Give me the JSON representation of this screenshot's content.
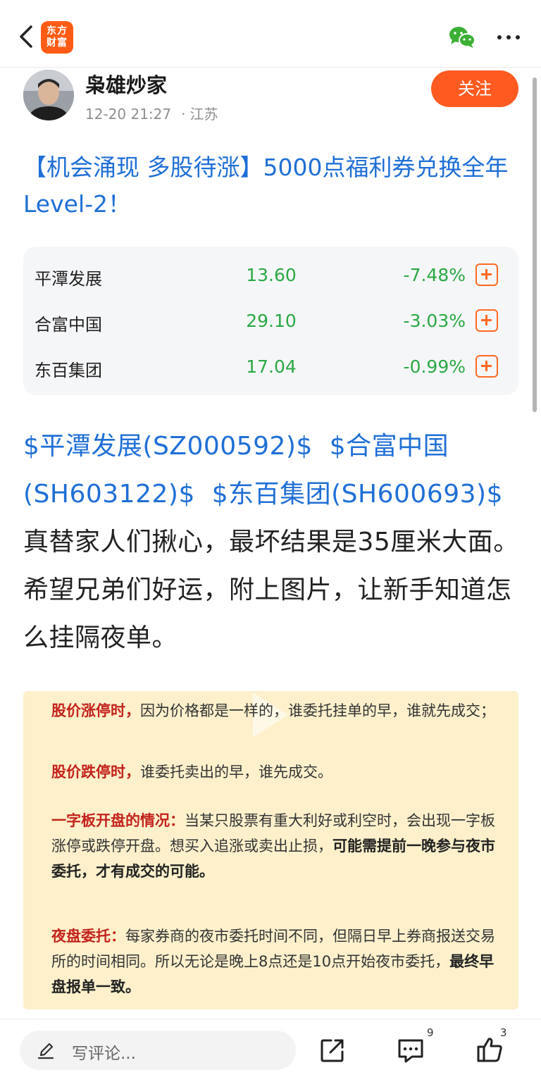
{
  "app": {
    "logo_line1": "东方",
    "logo_line2": "财富"
  },
  "author": {
    "name": "枭雄炒家",
    "time": "12-20 21:27",
    "location": "江苏",
    "follow_label": "关注"
  },
  "post": {
    "title": "【机会涌现 多股待涨】5000点福利券兑换全年Level-2！",
    "body_links": [
      "$平潭发展(SZ000592)$",
      "$合富中国(SH603122)$",
      "$东百集团(SH600693)$"
    ],
    "body_text": "真替家人们揪心，最坏结果是35厘米大面。希望兄弟们好运，附上图片，让新手知道怎么挂隔夜单。"
  },
  "stocks": [
    {
      "name": "平潭发展",
      "price": "13.60",
      "change": "-7.48%"
    },
    {
      "name": "合富中国",
      "price": "29.10",
      "change": "-3.03%"
    },
    {
      "name": "东百集团",
      "price": "17.04",
      "change": "-0.99%"
    }
  ],
  "image_text": {
    "p1_red": "股价涨停时，",
    "p1_text": "因为价格都是一样的，谁委托挂单的早，谁就先成交；",
    "p2_red": "股价跌停时，",
    "p2_text": "谁委托卖出的早，谁先成交。",
    "p3_red": "一字板开盘的情况：",
    "p3_text": "当某只股票有重大利好或利空时，会出现一字板涨停或跌停开盘。想买入追涨或卖出止损，",
    "p3_bold": "可能需提前一晚参与夜市委托，才有成交的可能。",
    "p4_red": "夜盘委托：",
    "p4_text": "每家券商的夜市委托时间不同，但隔日早上券商报送交易所的时间相同。所以无论是晚上8点还是10点开始夜市委托，",
    "p4_bold": "最终早盘报单一致。"
  },
  "bottom_bar": {
    "comment_placeholder": "写评论...",
    "comment_count": "9",
    "like_count": "3"
  },
  "colors": {
    "accent_orange": "#ff5a1f",
    "link_blue": "#1f6fd6",
    "down_green": "#2aa944",
    "note_bg": "#fdf0cb"
  }
}
